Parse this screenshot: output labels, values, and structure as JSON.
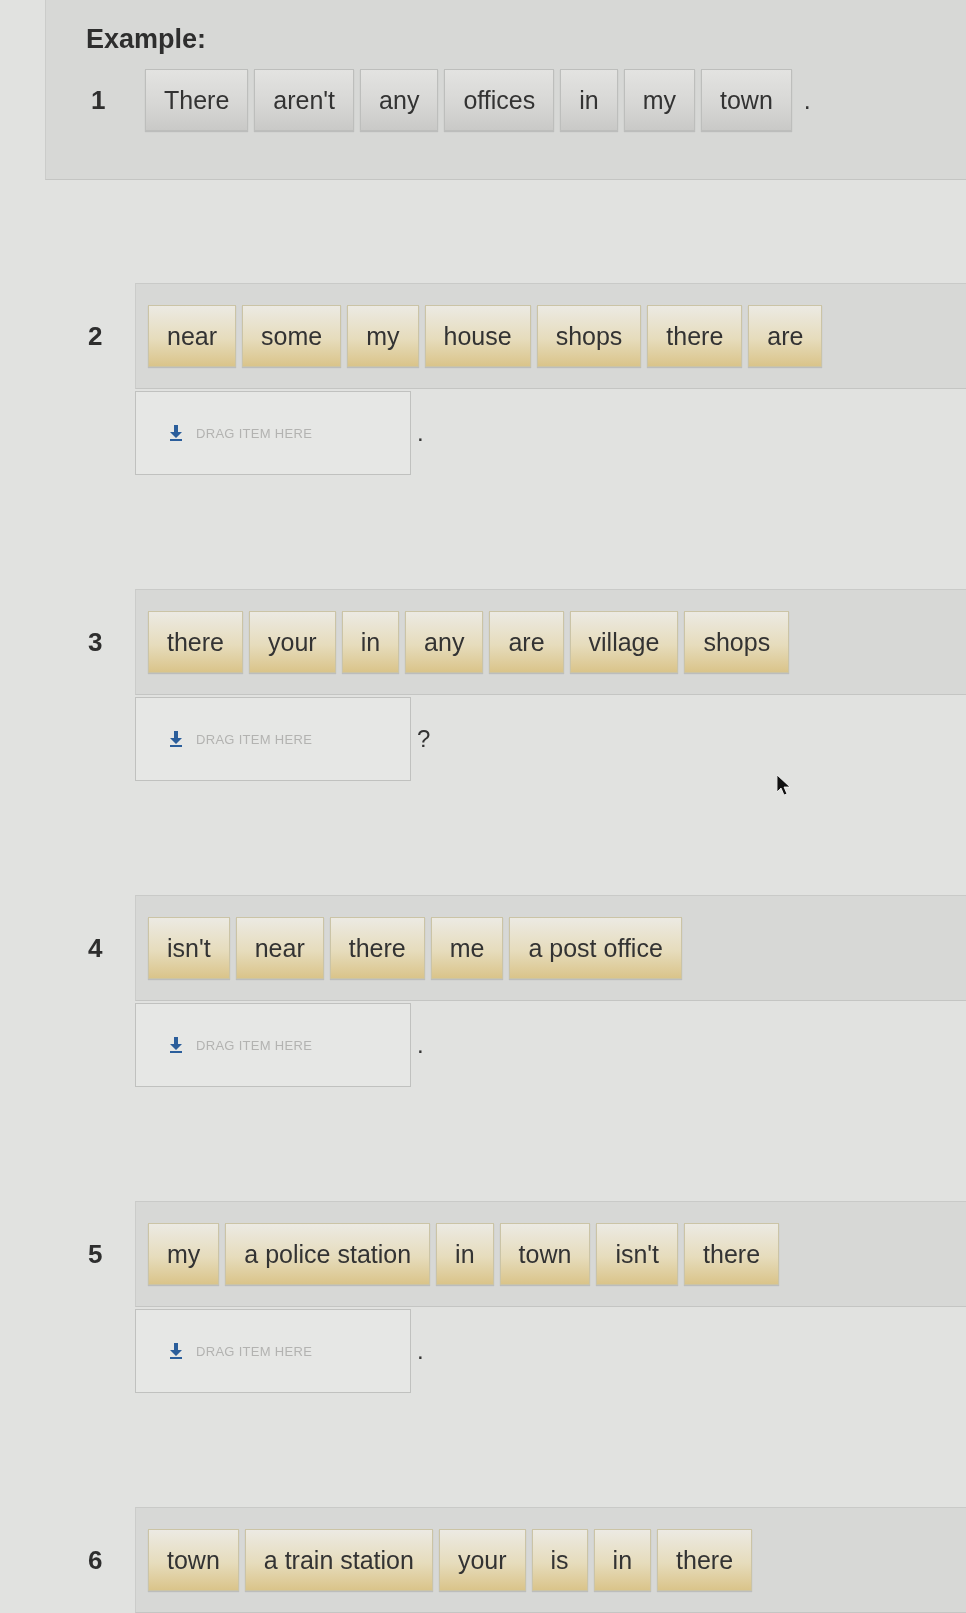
{
  "example": {
    "heading": "Example:",
    "number": "1",
    "words": [
      "There",
      "aren't",
      "any",
      "offices",
      "in",
      "my",
      "town"
    ],
    "end": "."
  },
  "questions": [
    {
      "number": "2",
      "words": [
        "near",
        "some",
        "my",
        "house",
        "shops",
        "there",
        "are"
      ],
      "answer": {
        "placeholder": "DRAG ITEM HERE"
      },
      "end": "."
    },
    {
      "number": "3",
      "words": [
        "there",
        "your",
        "in",
        "any",
        "are",
        "village",
        "shops"
      ],
      "answer": {
        "placeholder": "DRAG ITEM HERE"
      },
      "end": "?"
    },
    {
      "number": "4",
      "words": [
        "isn't",
        "near",
        "there",
        "me",
        "a post office"
      ],
      "answer": {
        "placeholder": "DRAG ITEM HERE"
      },
      "end": "."
    },
    {
      "number": "5",
      "words": [
        "my",
        "a police station",
        "in",
        "town",
        "isn't",
        "there"
      ],
      "answer": {
        "placeholder": "DRAG ITEM HERE"
      },
      "end": "."
    },
    {
      "number": "6",
      "words": [
        "town",
        "a train station",
        "your",
        "is",
        "in",
        "there"
      ]
    }
  ]
}
